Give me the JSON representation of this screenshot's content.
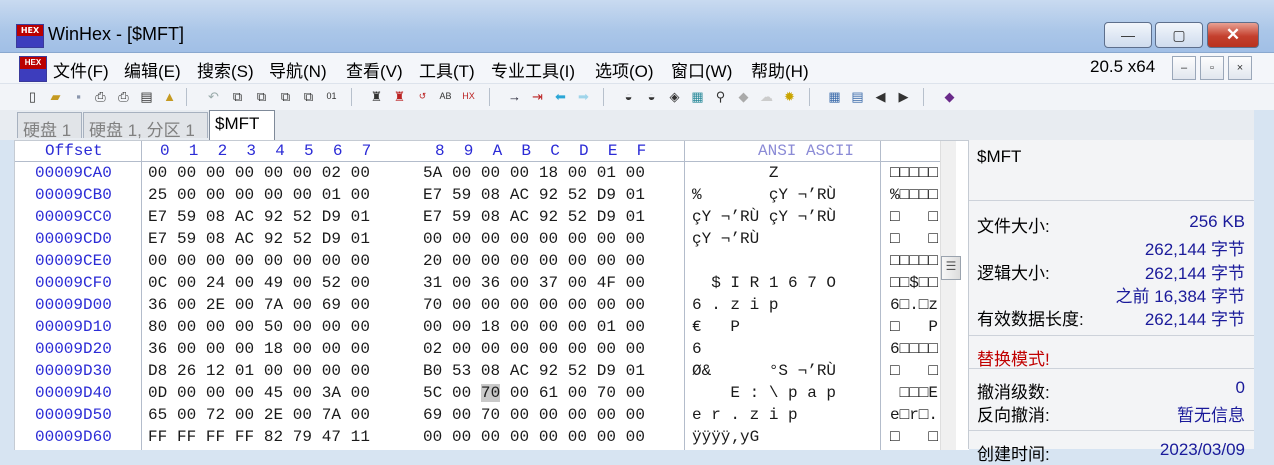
{
  "window": {
    "icon_text": "HEX",
    "title": "WinHex - [$MFT]",
    "minimize": "—",
    "maximize": "▢",
    "close": "✕"
  },
  "menu": {
    "items": [
      "文件(F)",
      "编辑(E)",
      "搜索(S)",
      "导航(N)",
      "查看(V)",
      "工具(T)",
      "专业工具(I)",
      "选项(O)",
      "窗口(W)",
      "帮助(H)"
    ],
    "zoom": "20.5 x64",
    "mdi_min": "–",
    "mdi_restore": "▫",
    "mdi_close": "×"
  },
  "toolbar": {
    "icons": [
      "new-file-icon",
      "open-file-icon",
      "save-icon",
      "print-icon",
      "print-preview-icon",
      "properties-icon",
      "export-icon",
      "undo-icon",
      "copy-icon",
      "cut-icon",
      "paste-icon",
      "paste-special-icon",
      "hex-icon",
      "find-text-icon",
      "find-hex-icon",
      "replace-icon",
      "replace-hex-icon",
      "goto-offset-icon",
      "goto-icon",
      "back-icon",
      "forward-icon",
      "disk-icon",
      "open-disk-icon",
      "ram-icon",
      "calculator-icon",
      "search-disk-icon",
      "snapshot-icon",
      "cloud-icon",
      "gear-icon",
      "tiles-icon",
      "table-icon",
      "prev-icon",
      "next-icon",
      "book-icon"
    ]
  },
  "tabs": [
    {
      "label": "硬盘 1",
      "active": false
    },
    {
      "label": "硬盘 1, 分区 1",
      "active": false
    },
    {
      "label": "$MFT",
      "active": true
    }
  ],
  "hex": {
    "header_offset": "Offset",
    "header_cols": [
      "0",
      "1",
      "2",
      "3",
      "4",
      "5",
      "6",
      "7",
      "8",
      "9",
      "A",
      "B",
      "C",
      "D",
      "E",
      "F"
    ],
    "header_ansi": "ANSI ASCII",
    "rows": [
      {
        "offset": "00009CA0",
        "bytes1": "00 00 00 00 00 00 02 00",
        "bytes2": "5A 00 00 00 18 00 01 00",
        "ansi": "        Z       ",
        "ascii": "□□□□□"
      },
      {
        "offset": "00009CB0",
        "bytes1": "25 00 00 00 00 00 01 00",
        "bytes2": "E7 59 08 AC 92 52 D9 01",
        "ansi": "%       çY ¬’RÙ ",
        "ascii": "%□□□□"
      },
      {
        "offset": "00009CC0",
        "bytes1": "E7 59 08 AC 92 52 D9 01",
        "bytes2": "E7 59 08 AC 92 52 D9 01",
        "ansi": "çY ¬’RÙ çY ¬’RÙ ",
        "ascii": "□   □"
      },
      {
        "offset": "00009CD0",
        "bytes1": "E7 59 08 AC 92 52 D9 01",
        "bytes2": "00 00 00 00 00 00 00 00",
        "ansi": "çY ¬’RÙ         ",
        "ascii": "□   □"
      },
      {
        "offset": "00009CE0",
        "bytes1": "00 00 00 00 00 00 00 00",
        "bytes2": "20 00 00 00 00 00 00 00",
        "ansi": "                ",
        "ascii": "□□□□□"
      },
      {
        "offset": "00009CF0",
        "bytes1": "0C 00 24 00 49 00 52 00",
        "bytes2": "31 00 36 00 37 00 4F 00",
        "ansi": "  $ I R 1 6 7 O ",
        "ascii": "□□$□□"
      },
      {
        "offset": "00009D00",
        "bytes1": "36 00 2E 00 7A 00 69 00",
        "bytes2": "70 00 00 00 00 00 00 00",
        "ansi": "6 . z i p       ",
        "ascii": "6□.□z"
      },
      {
        "offset": "00009D10",
        "bytes1": "80 00 00 00 50 00 00 00",
        "bytes2": "00 00 18 00 00 00 01 00",
        "ansi": "€   P           ",
        "ascii": "□   P"
      },
      {
        "offset": "00009D20",
        "bytes1": "36 00 00 00 18 00 00 00",
        "bytes2": "02 00 00 00 00 00 00 00",
        "ansi": "6               ",
        "ascii": "6□□□□"
      },
      {
        "offset": "00009D30",
        "bytes1": "D8 26 12 01 00 00 00 00",
        "bytes2": "B0 53 08 AC 92 52 D9 01",
        "ansi": "Ø&      °S ¬’RÙ ",
        "ascii": "□   □"
      },
      {
        "offset": "00009D40",
        "bytes1": "0D 00 00 00 45 00 3A 00",
        "bytes2": "5C 00 70 00 61 00 70 00",
        "ansi": "    E : \\ p a p ",
        "ascii": " □□□E"
      },
      {
        "offset": "00009D50",
        "bytes1": "65 00 72 00 2E 00 7A 00",
        "bytes2": "69 00 70 00 00 00 00 00",
        "ansi": "e r . z i p     ",
        "ascii": "e□r□."
      },
      {
        "offset": "00009D60",
        "bytes1": "FF FF FF FF 82 79 47 11",
        "bytes2": "00 00 00 00 00 00 00 00",
        "ansi": "ÿÿÿÿ‚yG         ",
        "ascii": "□   □"
      }
    ],
    "cursor": {
      "row": 10,
      "byte_text": "70",
      "prefix": "5C 00 ",
      "suffix": " 00 61 00 70 00"
    }
  },
  "info": {
    "title": "$MFT",
    "file_size_label": "文件大小:",
    "file_size_kb": "256 KB",
    "file_size_bytes": "262,144 字节",
    "logical_size_label": "逻辑大小:",
    "logical_size": "262,144 字节",
    "previous_size": "之前 16,384 字节",
    "valid_length_label": "有效数据长度:",
    "valid_length": "262,144 字节",
    "mode": "替换模式!",
    "undo_level_label": "撤消级数:",
    "undo_level": "0",
    "reverse_undo_label": "反向撤消:",
    "reverse_undo": "暂无信息",
    "created_label": "创建时间:",
    "created_value": "2023/03/09"
  }
}
